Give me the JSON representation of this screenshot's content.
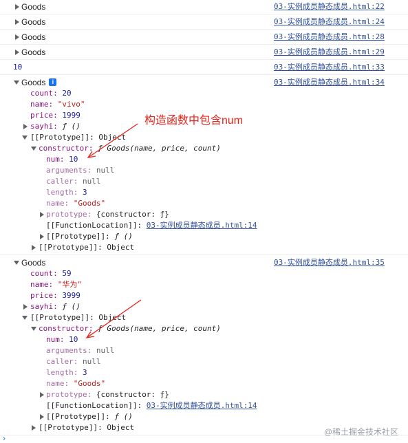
{
  "collapsed_logs": [
    {
      "label": "Goods",
      "source": "03-实例成员静态成员.html:22"
    },
    {
      "label": "Goods",
      "source": "03-实例成员静态成员.html:24"
    },
    {
      "label": "Goods",
      "source": "03-实例成员静态成员.html:28"
    },
    {
      "label": "Goods",
      "source": "03-实例成员静态成员.html:29"
    }
  ],
  "num_log": {
    "value": "10",
    "source": "03-实例成员静态成员.html:33"
  },
  "obj1": {
    "label": "Goods",
    "info_icon": "i",
    "source": "03-实例成员静态成员.html:34",
    "count_key": "count:",
    "count_val": "20",
    "name_key": "name:",
    "name_val": "\"vivo\"",
    "price_key": "price:",
    "price_val": "1999",
    "sayhi_key": "sayhi:",
    "sayhi_val": "ƒ ()",
    "proto_key": "[[Prototype]]:",
    "proto_val": "Object",
    "ctor_key": "constructor:",
    "ctor_val": "ƒ Goods(name, price, count)",
    "num_key": "num:",
    "num_val": "10",
    "arguments_key": "arguments:",
    "arguments_val": "null",
    "caller_key": "caller:",
    "caller_val": "null",
    "length_key": "length:",
    "length_val": "3",
    "fname_key": "name:",
    "fname_val": "\"Goods\"",
    "prototype_key": "prototype:",
    "prototype_val": "{constructor: ƒ}",
    "floc_key": "[[FunctionLocation]]:",
    "floc_val": "03-实例成员静态成员.html:14",
    "fproto_key": "[[Prototype]]:",
    "fproto_val": "ƒ ()",
    "oproto_key": "[[Prototype]]:",
    "oproto_val": "Object"
  },
  "obj2": {
    "label": "Goods",
    "source": "03-实例成员静态成员.html:35",
    "count_key": "count:",
    "count_val": "59",
    "name_key": "name:",
    "name_val": "\"华为\"",
    "price_key": "price:",
    "price_val": "3999",
    "sayhi_key": "sayhi:",
    "sayhi_val": "ƒ ()",
    "proto_key": "[[Prototype]]:",
    "proto_val": "Object",
    "ctor_key": "constructor:",
    "ctor_val": "ƒ Goods(name, price, count)",
    "num_key": "num:",
    "num_val": "10",
    "arguments_key": "arguments:",
    "arguments_val": "null",
    "caller_key": "caller:",
    "caller_val": "null",
    "length_key": "length:",
    "length_val": "3",
    "fname_key": "name:",
    "fname_val": "\"Goods\"",
    "prototype_key": "prototype:",
    "prototype_val": "{constructor: ƒ}",
    "floc_key": "[[FunctionLocation]]:",
    "floc_val": "03-实例成员静态成员.html:14",
    "fproto_key": "[[Prototype]]:",
    "fproto_val": "ƒ ()",
    "oproto_key": "[[Prototype]]:",
    "oproto_val": "Object"
  },
  "annotation": "构造函数中包含num",
  "watermark": "@稀土掘金技术社区",
  "prompt": "›",
  "colors": {
    "annotation": "#e8231a",
    "link": "#2f4f9c",
    "key": "#881280",
    "string": "#c41a16",
    "number": "#1a1aa6"
  }
}
